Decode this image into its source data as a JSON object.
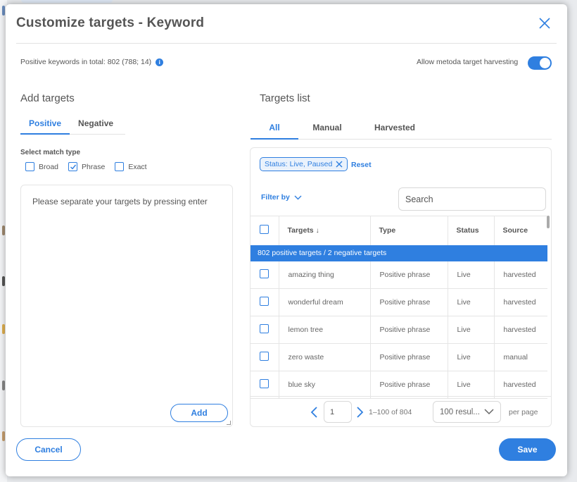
{
  "dialog": {
    "title": "Customize targets - Keyword",
    "positive_total": "Positive keywords in total: 802 (788; 14)",
    "info_icon": "info-icon",
    "harvest_label": "Allow metoda target harvesting",
    "harvest_enabled": true
  },
  "add_targets": {
    "heading": "Add targets",
    "tabs": [
      {
        "label": "Positive",
        "active": true
      },
      {
        "label": "Negative",
        "active": false
      }
    ],
    "match_type_label": "Select match type",
    "match_types": [
      {
        "label": "Broad",
        "checked": false
      },
      {
        "label": "Phrase",
        "checked": true
      },
      {
        "label": "Exact",
        "checked": false
      }
    ],
    "textarea_placeholder": "Please separate your targets by pressing enter",
    "add_label": "Add"
  },
  "targets_list": {
    "heading": "Targets list",
    "tabs": [
      {
        "label": "All",
        "active": true
      },
      {
        "label": "Manual",
        "active": false
      },
      {
        "label": "Harvested",
        "active": false
      }
    ],
    "filter_chip": "Status: Live, Paused",
    "reset_label": "Reset",
    "filter_by_label": "Filter by",
    "search_placeholder": "Search",
    "columns": {
      "targets": "Targets",
      "type": "Type",
      "status": "Status",
      "source": "Source"
    },
    "sort_arrow": "↓",
    "summary_banner": "802 positive targets / 2 negative targets",
    "rows": [
      {
        "target": "amazing thing",
        "type": "Positive phrase",
        "status": "Live",
        "source": "harvested"
      },
      {
        "target": "wonderful dream",
        "type": "Positive phrase",
        "status": "Live",
        "source": "harvested"
      },
      {
        "target": "lemon tree",
        "type": "Positive phrase",
        "status": "Live",
        "source": "harvested"
      },
      {
        "target": "zero waste",
        "type": "Positive phrase",
        "status": "Live",
        "source": "manual"
      },
      {
        "target": "blue sky",
        "type": "Positive phrase",
        "status": "Live",
        "source": "harvested"
      }
    ],
    "pagination": {
      "page": "1",
      "range": "1–100 of 804",
      "page_size": "100 resul...",
      "per_page_label": "per page"
    }
  },
  "footer": {
    "cancel_label": "Cancel",
    "save_label": "Save"
  },
  "colors": {
    "accent": "#2f7fe0"
  }
}
